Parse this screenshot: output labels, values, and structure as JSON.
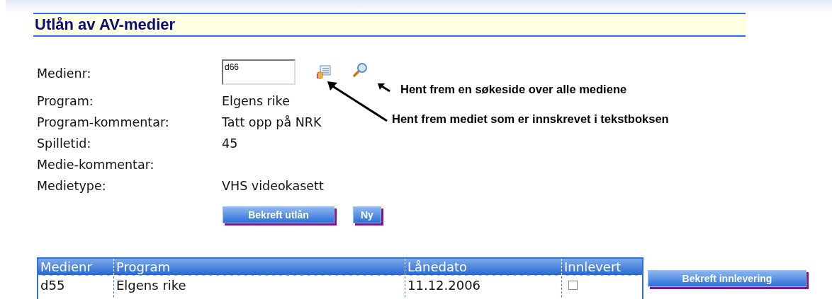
{
  "title": "Utlån av AV-medier",
  "form": {
    "medienr_label": "Medienr:",
    "medienr_value": "d66",
    "fields": [
      {
        "label": "Program:",
        "value": "Elgens rike"
      },
      {
        "label": "Program-kommentar:",
        "value": "Tatt opp på NRK"
      },
      {
        "label": "Spilletid:",
        "value": "45"
      },
      {
        "label": "Medie-kommentar:"
      },
      {
        "label": "Medietype:",
        "value": "VHS videokasett"
      }
    ]
  },
  "annotations": [
    {
      "kind": "search",
      "text": "Hent frem en søkeside over alle mediene"
    },
    {
      "kind": "fetch",
      "text": "Hent frem mediet som er innskrevet i tekstboksen"
    }
  ],
  "buttons": [
    "Bekreft utlån",
    "Ny"
  ],
  "table": {
    "columns": [
      "Medienr",
      "Program",
      "Lånedato",
      "Innlevert"
    ],
    "rows": [
      {
        "medienr": "d55",
        "program": "Elgens rike",
        "date": "11.12.2006",
        "returned": false
      }
    ]
  },
  "return_button": "Bekreft innlevering"
}
